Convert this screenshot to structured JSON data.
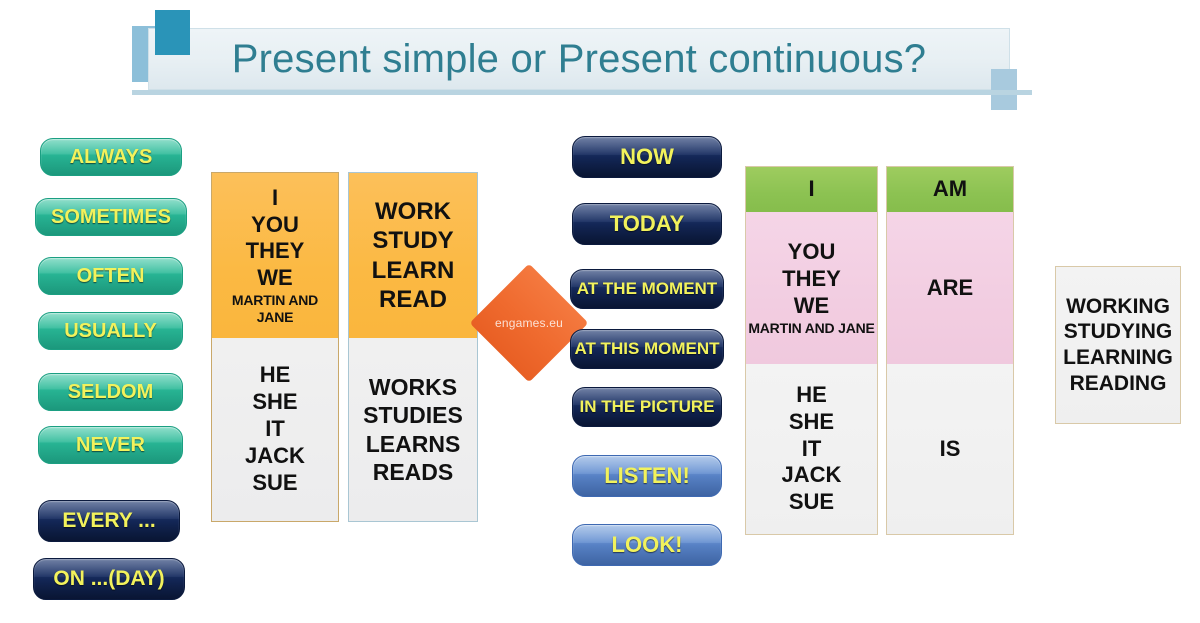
{
  "title": {
    "text": "Present simple or Present continuous?",
    "color": "#2f7e91"
  },
  "watermark": {
    "label": "engames.eu",
    "color": "#ef6a2e"
  },
  "frequency_adverbs": {
    "group_label": "frequency adverbs",
    "items": [
      {
        "label": "ALWAYS",
        "style": "green"
      },
      {
        "label": "SOMETIMES",
        "style": "green"
      },
      {
        "label": "OFTEN",
        "style": "green"
      },
      {
        "label": "USUALLY",
        "style": "green"
      },
      {
        "label": "SELDOM",
        "style": "green"
      },
      {
        "label": "NEVER",
        "style": "green"
      },
      {
        "label": "EVERY ...",
        "style": "navy"
      },
      {
        "label": "ON ...(DAY)",
        "style": "navy"
      }
    ]
  },
  "time_expressions": {
    "group_label": "present continuous time expressions",
    "items": [
      {
        "label": "NOW",
        "style": "navy"
      },
      {
        "label": "TODAY",
        "style": "navy"
      },
      {
        "label": "AT THE MOMENT",
        "style": "navy"
      },
      {
        "label": "AT THIS MOMENT",
        "style": "navy"
      },
      {
        "label": "IN THE PICTURE",
        "style": "navy"
      },
      {
        "label": "LISTEN!",
        "style": "blue"
      },
      {
        "label": "LOOK!",
        "style": "blue"
      }
    ]
  },
  "present_simple": {
    "subject_column": {
      "base_form_subjects": [
        "I",
        "YOU",
        "THEY",
        "WE"
      ],
      "base_form_extra": "MARTIN AND JANE",
      "s_form_subjects": [
        "HE",
        "SHE",
        "IT",
        "JACK",
        "SUE"
      ]
    },
    "verb_column": {
      "base_form_verbs": [
        "WORK",
        "STUDY",
        "LEARN",
        "READ"
      ],
      "s_form_verbs": [
        "WORKS",
        "STUDIES",
        "LEARNS",
        "READS"
      ]
    }
  },
  "present_continuous": {
    "subject_column": {
      "am_subject": "I",
      "are_subjects": [
        "YOU",
        "THEY",
        "WE"
      ],
      "are_extra": "MARTIN AND JANE",
      "is_subjects": [
        "HE",
        "SHE",
        "IT",
        "JACK",
        "SUE"
      ]
    },
    "be_column": {
      "am": "AM",
      "are": "ARE",
      "is": "IS"
    },
    "ing_column": {
      "verbs": [
        "WORKING",
        "STUDYING",
        "LEARNING",
        "READING"
      ]
    }
  }
}
